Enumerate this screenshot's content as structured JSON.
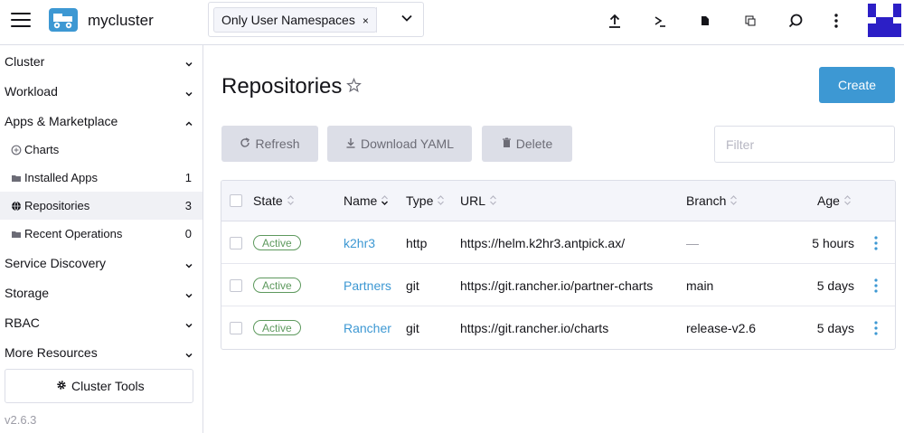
{
  "header": {
    "cluster_name": "mycluster",
    "namespace_chip": "Only User Namespaces",
    "namespace_chip_remove": "×",
    "icons": [
      "menu-icon",
      "cluster-icon",
      "upload-icon",
      "shell-icon",
      "file-icon",
      "copy-icon",
      "search-icon",
      "more-vertical-icon",
      "avatar"
    ]
  },
  "sidebar": {
    "groups": {
      "cluster": "Cluster",
      "workload": "Workload",
      "apps": "Apps & Marketplace",
      "service_discovery": "Service Discovery",
      "storage": "Storage",
      "rbac": "RBAC",
      "more_resources": "More Resources"
    },
    "apps_items": [
      {
        "label": "Charts",
        "count": ""
      },
      {
        "label": "Installed Apps",
        "count": "1"
      },
      {
        "label": "Repositories",
        "count": "3"
      },
      {
        "label": "Recent Operations",
        "count": "0"
      }
    ],
    "cluster_tools": "Cluster Tools",
    "version": "v2.6.3"
  },
  "main": {
    "title": "Repositories",
    "create_label": "Create",
    "refresh_label": "Refresh",
    "download_label": "Download YAML",
    "delete_label": "Delete",
    "filter_placeholder": "Filter",
    "columns": [
      "State",
      "Name",
      "Type",
      "URL",
      "Branch",
      "Age"
    ],
    "rows": [
      {
        "state": "Active",
        "name": "k2hr3",
        "type": "http",
        "url": "https://helm.k2hr3.antpick.ax/",
        "branch": "—",
        "age": "5 hours"
      },
      {
        "state": "Active",
        "name": "Partners",
        "type": "git",
        "url": "https://git.rancher.io/partner-charts",
        "branch": "main",
        "age": "5 days"
      },
      {
        "state": "Active",
        "name": "Rancher",
        "type": "git",
        "url": "https://git.rancher.io/charts",
        "branch": "release-v2.6",
        "age": "5 days"
      }
    ]
  },
  "colors": {
    "accent": "#3d98d3",
    "active_badge": "#5d995d",
    "disabled_button_bg": "#dcdee7"
  }
}
